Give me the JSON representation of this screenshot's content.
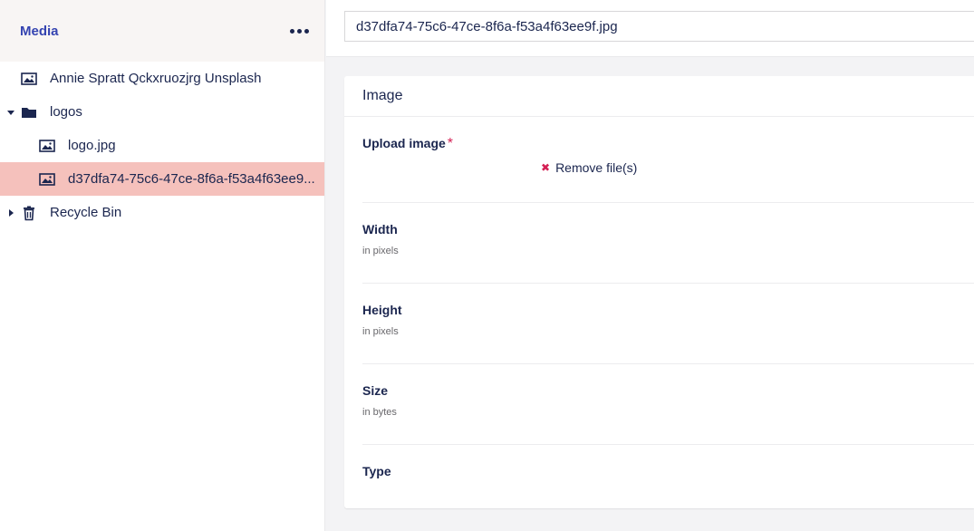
{
  "sidebar": {
    "title": "Media",
    "more_icon": "more-horizontal-icon",
    "tree": [
      {
        "label": "Annie Spratt Qckxruozjrg Unsplash",
        "icon": "image-icon",
        "level": 0,
        "caret": "none",
        "selected": false
      },
      {
        "label": "logos",
        "icon": "folder-icon",
        "level": 0,
        "caret": "expanded",
        "selected": false
      },
      {
        "label": "logo.jpg",
        "icon": "image-icon",
        "level": 1,
        "caret": "none",
        "selected": false
      },
      {
        "label": "d37dfa74-75c6-47ce-8f6a-f53a4f63ee9...",
        "icon": "image-icon",
        "level": 1,
        "caret": "none",
        "selected": true
      },
      {
        "label": "Recycle Bin",
        "icon": "trash-icon",
        "level": 0,
        "caret": "collapsed",
        "selected": false
      }
    ]
  },
  "main": {
    "name_value": "d37dfa74-75c6-47ce-8f6a-f53a4f63ee9f.jpg",
    "panel": {
      "title": "Image",
      "upload": {
        "label": "Upload image",
        "required_mark": "*",
        "remove_label": "Remove file(s)"
      },
      "width": {
        "label": "Width",
        "desc": "in pixels"
      },
      "height": {
        "label": "Height",
        "desc": "in pixels"
      },
      "size": {
        "label": "Size",
        "desc": "in bytes"
      },
      "type": {
        "label": "Type"
      }
    }
  },
  "colors": {
    "accent": "#3544b1",
    "text": "#1b264f",
    "selected_bg": "#f5c1bc",
    "required": "#d42054"
  }
}
